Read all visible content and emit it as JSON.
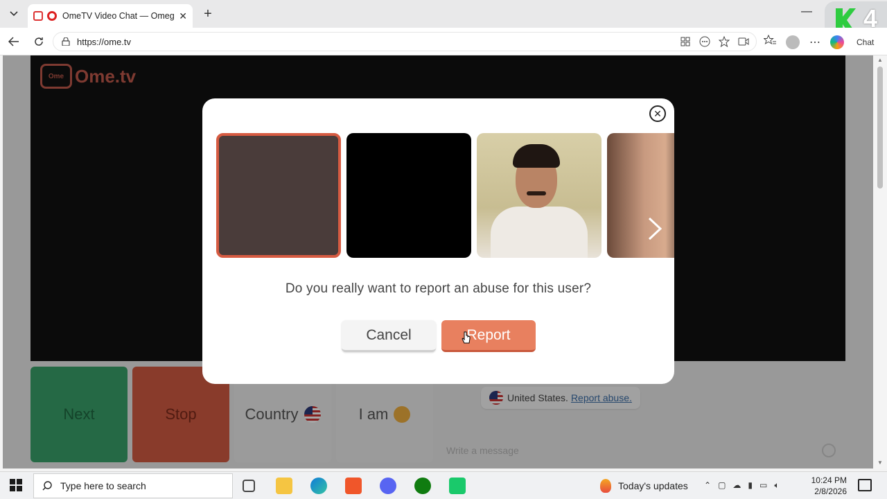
{
  "browser": {
    "tab_title": "OmeTV Video Chat — Omegle",
    "url": "https://ome.tv",
    "chat_label": "Chat",
    "corner_badge": "4"
  },
  "page": {
    "logo_text": "Ome.tv",
    "controls": {
      "next": "Next",
      "stop": "Stop",
      "country": "Country",
      "iam": "I am"
    },
    "chat": {
      "message_country": "United States.",
      "message_link": "Report abuse.",
      "input_placeholder": "Write a message"
    }
  },
  "modal": {
    "question": "Do you really want to report an abuse for this user?",
    "cancel_label": "Cancel",
    "report_label": "Report"
  },
  "taskbar": {
    "search_placeholder": "Type here to search",
    "news_label": "Today's updates",
    "time": "10:24 PM",
    "date": "2/8/2026"
  },
  "colors": {
    "accent": "#e8805f",
    "next_green": "#3aa16b",
    "stop_red": "#d35b42"
  }
}
